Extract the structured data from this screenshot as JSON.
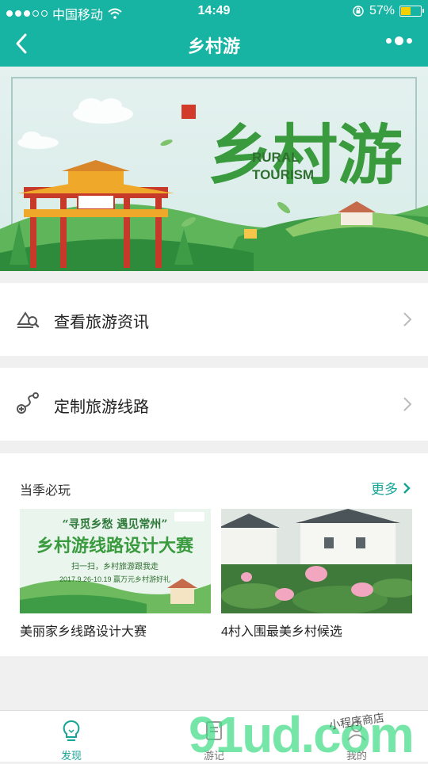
{
  "status_bar": {
    "carrier": "中国移动",
    "time": "14:49",
    "battery": "57%",
    "battery_level": 0.57
  },
  "nav": {
    "title": "乡村游"
  },
  "banner": {
    "title_text": "乡村游",
    "subtitle_line1": "RURAL",
    "subtitle_line2": "TOURISM"
  },
  "menu": {
    "items": [
      {
        "label": "查看旅游资讯",
        "icon": "news-search-icon"
      },
      {
        "label": "定制旅游线路",
        "icon": "route-plus-icon"
      }
    ]
  },
  "season": {
    "title": "当季必玩",
    "more_label": "更多",
    "cards": [
      {
        "caption": "美丽家乡线路设计大赛",
        "poster_top": "“寻觅乡愁  遇见常州”",
        "poster_main": "乡村游线路设计大赛",
        "poster_sub": "扫一扫，乡村旅游跟我走",
        "poster_date": "2017.9.26-10.19  赢万元乡村游好礼"
      },
      {
        "caption": "4村入围最美乡村候选"
      }
    ]
  },
  "tabs": [
    {
      "label": "发现",
      "icon": "lightbulb-icon",
      "active": true
    },
    {
      "label": "游记",
      "icon": "notes-icon",
      "active": false
    },
    {
      "label": "我的",
      "icon": "person-icon",
      "active": false
    }
  ],
  "watermark": {
    "text": "91ud.com",
    "sub": "小程序商店"
  },
  "colors": {
    "primary": "#17b3a3",
    "link": "#17a596"
  }
}
